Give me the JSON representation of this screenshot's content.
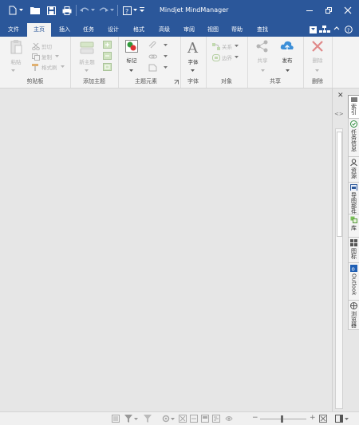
{
  "window": {
    "title": "Mindjet MindManager"
  },
  "ribbon_tabs": [
    "文件",
    "主页",
    "插入",
    "任务",
    "设计",
    "格式",
    "高级",
    "审阅",
    "视图",
    "帮助",
    "查找"
  ],
  "active_tab": "主页",
  "groups": {
    "clipboard": {
      "label": "剪贴板",
      "paste": "粘贴",
      "cut": "剪切",
      "copy": "复制",
      "format_painter": "格式刷"
    },
    "add_topic": {
      "label": "添加主题",
      "new_topic": "新主题"
    },
    "topic_elements": {
      "label": "主题元素",
      "markers": "标记"
    },
    "font": {
      "label": "字体",
      "font": "字体"
    },
    "objects": {
      "label": "对象",
      "relationship": "关系",
      "boundary": "边界"
    },
    "share": {
      "label": "共享",
      "share": "共享",
      "publish": "发布"
    },
    "delete": {
      "label": "删除",
      "delete": "删除"
    }
  },
  "side_tabs": [
    "索引",
    "任务信息",
    "资源",
    "导图部件",
    "库",
    "图标",
    "Outlook",
    "浏览器"
  ],
  "colors": {
    "brand": "#2b579a",
    "ribbon_bg": "#f3f3f3",
    "canvas_bg": "#e6e6e6"
  }
}
